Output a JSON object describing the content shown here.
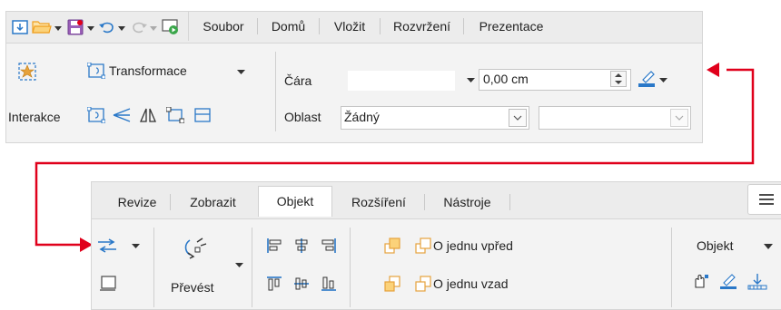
{
  "top": {
    "tabs": [
      "Soubor",
      "Domů",
      "Vložit",
      "Rozvržení",
      "Prezentace"
    ],
    "transform_label": "Transformace",
    "interaction_label": "Interakce",
    "line_label": "Čára",
    "line_width": "0,00 cm",
    "area_label": "Oblast",
    "area_value": "Žádný"
  },
  "bottom": {
    "tabs": [
      "Revize",
      "Zobrazit",
      "Objekt",
      "Rozšíření",
      "Nástroje"
    ],
    "selected_tab": "Objekt",
    "convert_label": "Převést",
    "forward_label": "O jednu vpřed",
    "backward_label": "O jednu vzad",
    "object_label": "Objekt"
  },
  "colors": {
    "accent_red": "#e0001b",
    "icon_blue": "#2a78c8",
    "icon_orange": "#e6a23c",
    "folder_orange": "#f0a020"
  }
}
